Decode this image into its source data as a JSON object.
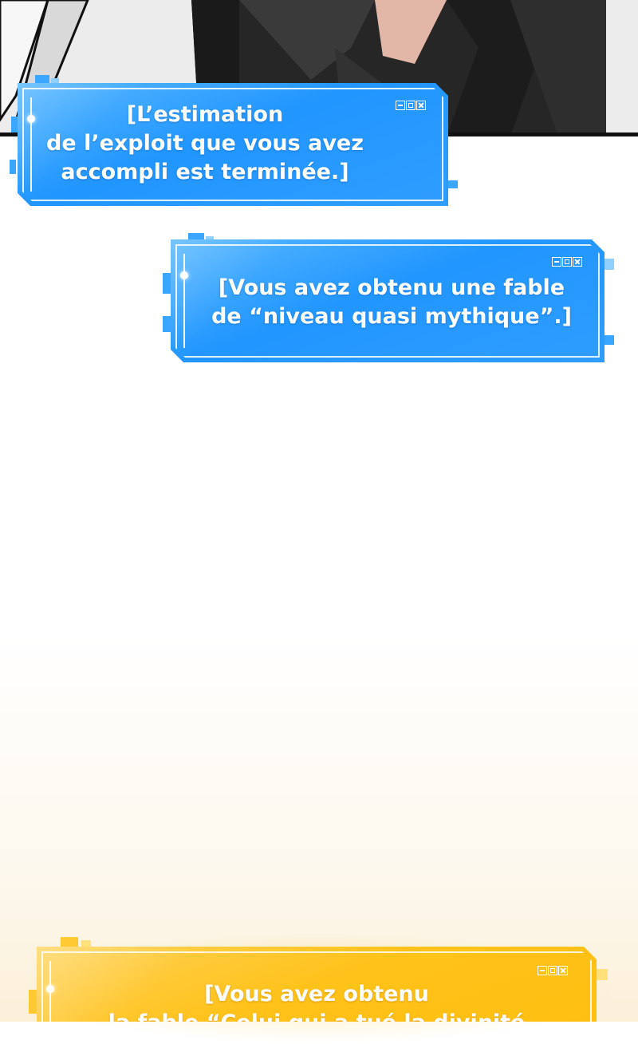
{
  "windows": {
    "estimation": {
      "lines": [
        "[L’estimation",
        "de l’exploit que vous avez",
        "accompli est terminée.]"
      ],
      "color": "#2196ff"
    },
    "fable_obtained": {
      "lines": [
        "[Vous avez obtenu une fable",
        "de “niveau quasi mythique”.]"
      ],
      "color": "#2196ff"
    },
    "fable_named": {
      "lines": [
        "[Vous avez obtenu",
        "la fable “Celui qui a tué la divinité"
      ],
      "color": "#ffc21a"
    }
  },
  "icons": {
    "window_controls": [
      "minimize-icon",
      "maximize-icon",
      "close-icon"
    ]
  }
}
